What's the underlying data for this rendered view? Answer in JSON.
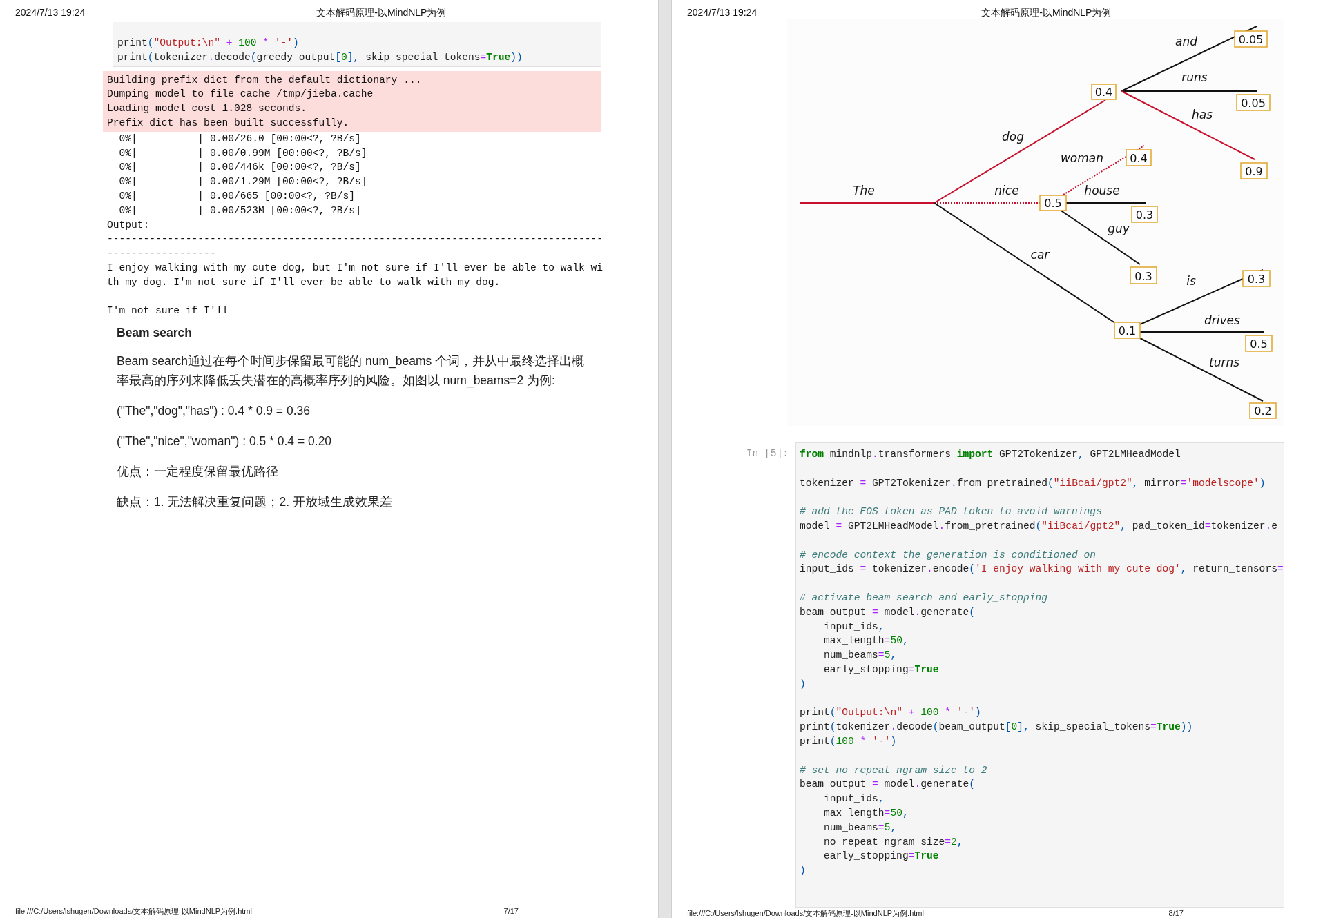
{
  "pages": [
    {
      "header": {
        "date": "2024/7/13 19:24",
        "title": "文本解码原理-以MindNLP为例"
      },
      "cells": [
        {
          "kind": "code",
          "blocks": [
            [
              [
                "print",
                {
                  "kind": "punc",
                  "text": "("
                },
                {
                  "kind": "str",
                  "text": "\"Output:\\n\""
                },
                {
                  "kind": "op",
                  "text": " + "
                },
                {
                  "kind": "num",
                  "text": "100"
                },
                {
                  "kind": "op",
                  "text": " * "
                },
                {
                  "kind": "str",
                  "text": "'-'"
                },
                {
                  "kind": "punc",
                  "text": ")"
                }
              ],
              [
                "print",
                {
                  "kind": "punc",
                  "text": "("
                },
                "tokenizer",
                {
                  "kind": "op",
                  "text": "."
                },
                "decode",
                {
                  "kind": "punc",
                  "text": "("
                },
                "greedy_output",
                {
                  "kind": "punc",
                  "text": "["
                },
                {
                  "kind": "num",
                  "text": "0"
                },
                {
                  "kind": "punc",
                  "text": "],"
                },
                " skip_special_tokens",
                {
                  "kind": "op",
                  "text": "="
                },
                {
                  "kind": "kw",
                  "text": "True"
                },
                {
                  "kind": "punc",
                  "text": "))"
                }
              ]
            ]
          ]
        },
        {
          "kind": "stderr",
          "lines": [
            "Building prefix dict from the default dictionary ...",
            "Dumping model to file cache /tmp/jieba.cache",
            "Loading model cost 1.028 seconds.",
            "Prefix dict has been built successfully."
          ]
        },
        {
          "kind": "stdout",
          "lines": [
            "  0%|          | 0.00/26.0 [00:00<?, ?B/s]",
            "  0%|          | 0.00/0.99M [00:00<?, ?B/s]",
            "  0%|          | 0.00/446k [00:00<?, ?B/s]",
            "  0%|          | 0.00/1.29M [00:00<?, ?B/s]",
            "  0%|          | 0.00/665 [00:00<?, ?B/s]",
            "  0%|          | 0.00/523M [00:00<?, ?B/s]",
            "Output:",
            "----------------------------------------------------------------------------------------------------",
            "I enjoy walking with my cute dog, but I'm not sure if I'll ever be able to walk with my dog. I'm not sure if I'll ever be able to walk with my dog.\n\nI'm not sure if I'll"
          ]
        },
        {
          "kind": "markdown",
          "heading": "Beam search",
          "paragraphs": [
            "Beam search通过在每个时间步保留最可能的 num_beams 个词，并从中最终选择出概率最高的序列来降低丢失潜在的高概率序列的风险。如图以 num_beams=2 为例:",
            "(\"The\",\"dog\",\"has\") : 0.4 * 0.9 = 0.36",
            "(\"The\",\"nice\",\"woman\") : 0.5 * 0.4 = 0.20",
            "优点：一定程度保留最优路径",
            "缺点：1. 无法解决重复问题；2. 开放域生成效果差"
          ]
        }
      ],
      "footer": {
        "path": "file:///C:/Users/lshugen/Downloads/文本解码原理-以MindNLP为例.html",
        "page": "7/17"
      }
    },
    {
      "header": {
        "date": "2024/7/13 19:24",
        "title": "文本解码原理-以MindNLP为例"
      },
      "cells": [
        {
          "kind": "figure",
          "tree": {
            "word": "The",
            "kind": "greedy",
            "children": [
              {
                "word": "dog",
                "prob": "0.4",
                "kind": "greedy",
                "children": [
                  {
                    "word": "and",
                    "prob": "0.05",
                    "kind": "plain"
                  },
                  {
                    "word": "runs",
                    "prob": "0.05",
                    "kind": "plain"
                  },
                  {
                    "word": "has",
                    "prob": "0.9",
                    "kind": "greedy"
                  }
                ]
              },
              {
                "word": "nice",
                "prob": "0.5",
                "kind": "beam",
                "children": [
                  {
                    "word": "woman",
                    "prob": "0.4",
                    "kind": "beam"
                  },
                  {
                    "word": "house",
                    "prob": "0.3",
                    "kind": "plain"
                  },
                  {
                    "word": "guy",
                    "prob": "0.3",
                    "kind": "plain"
                  }
                ]
              },
              {
                "word": "car",
                "prob": "0.1",
                "kind": "plain",
                "children": [
                  {
                    "word": "is",
                    "prob": "0.3",
                    "kind": "plain"
                  },
                  {
                    "word": "drives",
                    "prob": "0.5",
                    "kind": "plain"
                  },
                  {
                    "word": "turns",
                    "prob": "0.2",
                    "kind": "plain"
                  }
                ]
              }
            ]
          }
        },
        {
          "kind": "code",
          "prompt": "In [5]:",
          "blocks": [
            [
              [
                {
                  "kind": "kw",
                  "text": "from"
                },
                " mindnlp",
                {
                  "kind": "op",
                  "text": "."
                },
                "transformers ",
                {
                  "kind": "kw",
                  "text": "import"
                },
                " GPT2Tokenizer",
                {
                  "kind": "punc",
                  "text": ","
                },
                " GPT2LMHeadModel"
              ]
            ],
            [
              [
                "tokenizer ",
                {
                  "kind": "op",
                  "text": "="
                },
                " GPT2Tokenizer",
                {
                  "kind": "op",
                  "text": "."
                },
                "from_pretrained",
                {
                  "kind": "punc",
                  "text": "("
                },
                {
                  "kind": "str",
                  "text": "\"iiBcai/gpt2\""
                },
                {
                  "kind": "punc",
                  "text": ","
                },
                " mirror",
                {
                  "kind": "op",
                  "text": "="
                },
                {
                  "kind": "str",
                  "text": "'modelscope'"
                },
                {
                  "kind": "punc",
                  "text": ")"
                }
              ]
            ],
            [
              [
                {
                  "kind": "comment",
                  "text": "# add the EOS token as PAD token to avoid warnings"
                }
              ],
              [
                "model ",
                {
                  "kind": "op",
                  "text": "="
                },
                " GPT2LMHeadModel",
                {
                  "kind": "op",
                  "text": "."
                },
                "from_pretrained",
                {
                  "kind": "punc",
                  "text": "("
                },
                {
                  "kind": "str",
                  "text": "\"iiBcai/gpt2\""
                },
                {
                  "kind": "punc",
                  "text": ","
                },
                " pad_token_id",
                {
                  "kind": "op",
                  "text": "="
                },
                "tokenizer",
                {
                  "kind": "op",
                  "text": "."
                },
                "e"
              ]
            ],
            [
              [
                {
                  "kind": "comment",
                  "text": "# encode context the generation is conditioned on"
                }
              ],
              [
                "input_ids ",
                {
                  "kind": "op",
                  "text": "="
                },
                " tokenizer",
                {
                  "kind": "op",
                  "text": "."
                },
                "encode",
                {
                  "kind": "punc",
                  "text": "("
                },
                {
                  "kind": "str",
                  "text": "'I enjoy walking with my cute dog'"
                },
                {
                  "kind": "punc",
                  "text": ","
                },
                " return_tensors",
                {
                  "kind": "op",
                  "text": "="
                }
              ]
            ],
            [
              [
                {
                  "kind": "comment",
                  "text": "# activate beam search and early_stopping"
                }
              ],
              [
                "beam_output ",
                {
                  "kind": "op",
                  "text": "="
                },
                " model",
                {
                  "kind": "op",
                  "text": "."
                },
                "generate",
                {
                  "kind": "punc",
                  "text": "("
                }
              ],
              [
                "    input_ids",
                {
                  "kind": "punc",
                  "text": ","
                }
              ],
              [
                "    max_length",
                {
                  "kind": "op",
                  "text": "="
                },
                {
                  "kind": "num",
                  "text": "50"
                },
                {
                  "kind": "punc",
                  "text": ","
                }
              ],
              [
                "    num_beams",
                {
                  "kind": "op",
                  "text": "="
                },
                {
                  "kind": "num",
                  "text": "5"
                },
                {
                  "kind": "punc",
                  "text": ","
                }
              ],
              [
                "    early_stopping",
                {
                  "kind": "op",
                  "text": "="
                },
                {
                  "kind": "kw",
                  "text": "True"
                }
              ],
              [
                {
                  "kind": "punc",
                  "text": ")"
                }
              ]
            ],
            [
              [
                "print",
                {
                  "kind": "punc",
                  "text": "("
                },
                {
                  "kind": "str",
                  "text": "\"Output:\\n\""
                },
                {
                  "kind": "op",
                  "text": " + "
                },
                {
                  "kind": "num",
                  "text": "100"
                },
                {
                  "kind": "op",
                  "text": " * "
                },
                {
                  "kind": "str",
                  "text": "'-'"
                },
                {
                  "kind": "punc",
                  "text": ")"
                }
              ],
              [
                "print",
                {
                  "kind": "punc",
                  "text": "("
                },
                "tokenizer",
                {
                  "kind": "op",
                  "text": "."
                },
                "decode",
                {
                  "kind": "punc",
                  "text": "("
                },
                "beam_output",
                {
                  "kind": "punc",
                  "text": "["
                },
                {
                  "kind": "num",
                  "text": "0"
                },
                {
                  "kind": "punc",
                  "text": "],"
                },
                " skip_special_tokens",
                {
                  "kind": "op",
                  "text": "="
                },
                {
                  "kind": "kw",
                  "text": "True"
                },
                {
                  "kind": "punc",
                  "text": "))"
                }
              ],
              [
                "print",
                {
                  "kind": "punc",
                  "text": "("
                },
                {
                  "kind": "num",
                  "text": "100"
                },
                {
                  "kind": "op",
                  "text": " * "
                },
                {
                  "kind": "str",
                  "text": "'-'"
                },
                {
                  "kind": "punc",
                  "text": ")"
                }
              ]
            ],
            [
              [
                {
                  "kind": "comment",
                  "text": "# set no_repeat_ngram_size to 2"
                }
              ],
              [
                "beam_output ",
                {
                  "kind": "op",
                  "text": "="
                },
                " model",
                {
                  "kind": "op",
                  "text": "."
                },
                "generate",
                {
                  "kind": "punc",
                  "text": "("
                }
              ],
              [
                "    input_ids",
                {
                  "kind": "punc",
                  "text": ","
                }
              ],
              [
                "    max_length",
                {
                  "kind": "op",
                  "text": "="
                },
                {
                  "kind": "num",
                  "text": "50"
                },
                {
                  "kind": "punc",
                  "text": ","
                }
              ],
              [
                "    num_beams",
                {
                  "kind": "op",
                  "text": "="
                },
                {
                  "kind": "num",
                  "text": "5"
                },
                {
                  "kind": "punc",
                  "text": ","
                }
              ],
              [
                "    no_repeat_ngram_size",
                {
                  "kind": "op",
                  "text": "="
                },
                {
                  "kind": "num",
                  "text": "2"
                },
                {
                  "kind": "punc",
                  "text": ","
                }
              ],
              [
                "    early_stopping",
                {
                  "kind": "op",
                  "text": "="
                },
                {
                  "kind": "kw",
                  "text": "True"
                }
              ],
              [
                {
                  "kind": "punc",
                  "text": ")"
                }
              ]
            ]
          ]
        }
      ],
      "footer": {
        "path": "file:///C:/Users/lshugen/Downloads/文本解码原理-以MindNLP为例.html",
        "page": "8/17"
      }
    }
  ]
}
